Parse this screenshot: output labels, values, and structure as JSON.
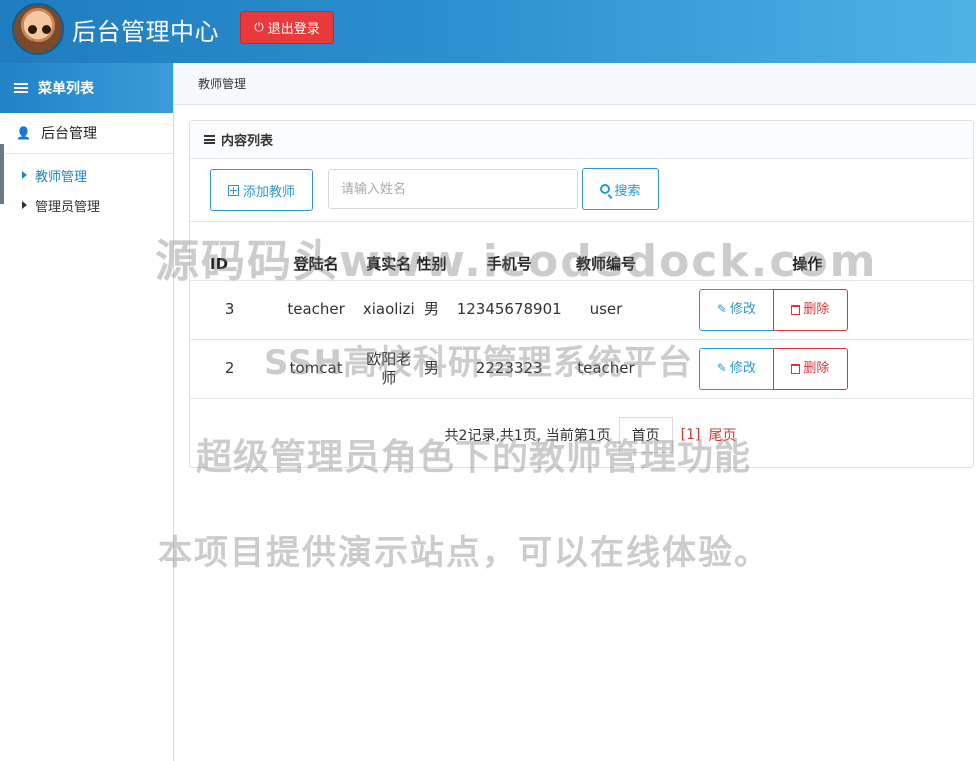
{
  "header": {
    "title": "后台管理中心",
    "logout_label": "退出登录"
  },
  "sidebar": {
    "menu_title": "菜单列表",
    "group_title": "后台管理",
    "items": [
      {
        "label": "教师管理",
        "active": true
      },
      {
        "label": "管理员管理",
        "active": false
      }
    ]
  },
  "breadcrumb": "教师管理",
  "panel": {
    "title": "内容列表",
    "add_label": "添加教师",
    "search_placeholder": "请输入姓名",
    "search_value": "",
    "search_label": "搜索"
  },
  "table": {
    "columns": [
      "ID",
      "登陆名",
      "真实名",
      "性别",
      "手机号",
      "教师编号",
      "操作"
    ],
    "rows": [
      {
        "id": "3",
        "login": "teacher",
        "name": "xiaolizi",
        "sex": "男",
        "phone": "12345678901",
        "no": "user"
      },
      {
        "id": "2",
        "login": "tomcat",
        "name": "欧阳老师",
        "sex": "男",
        "phone": "2223323",
        "no": "teacher"
      }
    ],
    "edit_label": "修改",
    "delete_label": "删除"
  },
  "pager": {
    "summary": "共2记录,共1页, 当前第1页",
    "first_label": "首页",
    "current": "[1]",
    "last_label": "尾页"
  },
  "watermarks": {
    "line1": "源码码头www.icodedock.com",
    "line2": "SSH高校科研管理系统平台",
    "line3": "超级管理员角色下的教师管理功能",
    "line4": "本项目提供演示站点，可以在线体验。"
  },
  "colors": {
    "header_start": "#1f7dbf",
    "header_end": "#4fb3e6",
    "accent": "#2b9ac9",
    "danger": "#d9363e",
    "logout_bg": "#e8393b"
  },
  "icons": {
    "logout": "power-icon",
    "menu": "list-icon",
    "group": "user-icon",
    "add": "plus-square-icon",
    "search": "search-icon",
    "edit": "pencil-square-icon",
    "delete": "trash-icon"
  }
}
